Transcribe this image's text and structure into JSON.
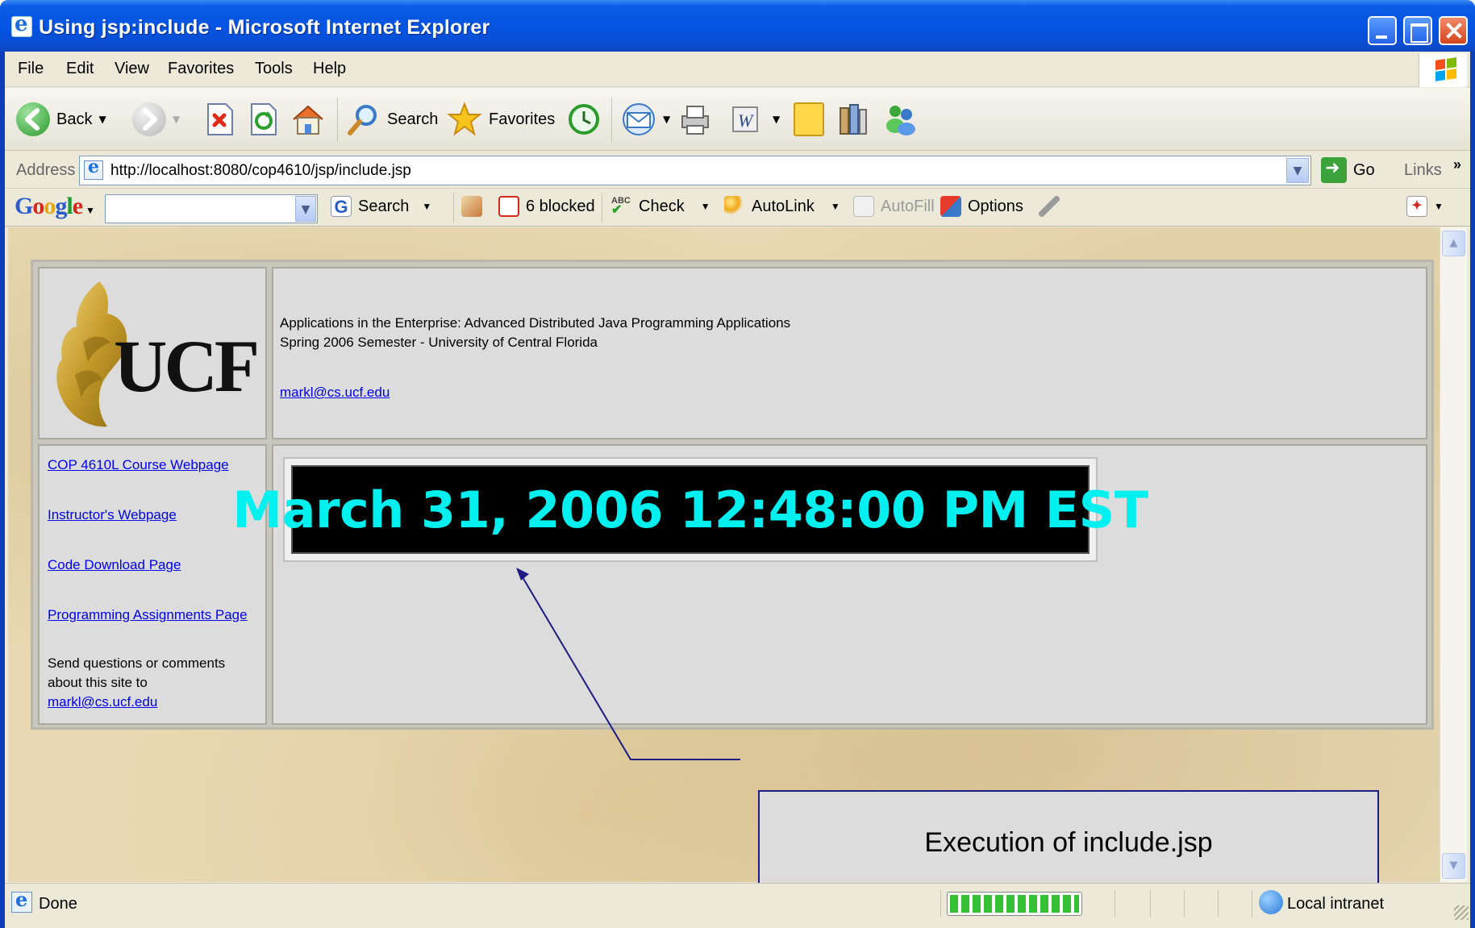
{
  "window": {
    "title": "Using jsp:include - Microsoft Internet Explorer"
  },
  "menu": {
    "items": [
      "File",
      "Edit",
      "View",
      "Favorites",
      "Tools",
      "Help"
    ]
  },
  "toolbar": {
    "back_label": "Back",
    "search_label": "Search",
    "favorites_label": "Favorites"
  },
  "address": {
    "label": "Address",
    "url": "http://localhost:8080/cop4610/jsp/include.jsp",
    "go_label": "Go",
    "links_label": "Links"
  },
  "google_toolbar": {
    "logo": "Google",
    "search_label": "Search",
    "blocked_label": "6 blocked",
    "check_label": "Check",
    "autolink_label": "AutoLink",
    "autofill_label": "AutoFill",
    "options_label": "Options"
  },
  "page": {
    "logo_text": "UCF",
    "header_line1": "Applications in the Enterprise: Advanced Distributed Java Programming Applications",
    "header_line2": "Spring 2006 Semester - University of Central Florida",
    "header_email": "markl@cs.ucf.edu",
    "nav_links": [
      "COP 4610L Course Webpage",
      "Instructor's Webpage",
      "Code Download Page",
      "Programming Assignments Page"
    ],
    "nav_note_line1": "Send questions or comments",
    "nav_note_line2": "about this site to",
    "nav_email": "markl@cs.ucf.edu",
    "clock_text": "March 31, 2006 12:48:00 PM EST"
  },
  "callout": {
    "text": "Execution of include.jsp"
  },
  "status": {
    "text": "Done",
    "zone": "Local intranet"
  },
  "colors": {
    "clock_text": "#00f0f0",
    "clock_bg": "#000000",
    "link": "#0000ee",
    "callout_border": "#1c1c84"
  }
}
